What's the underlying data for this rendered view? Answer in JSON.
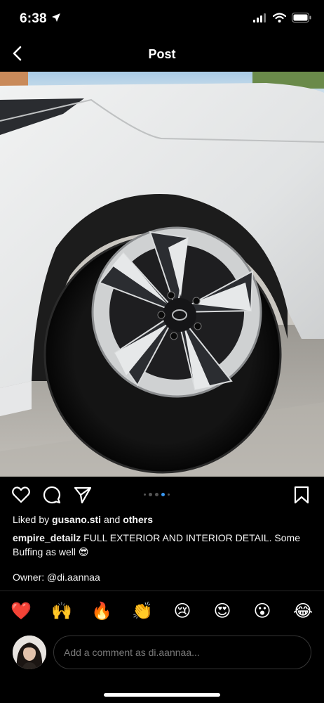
{
  "status": {
    "time": "6:38"
  },
  "nav": {
    "title": "Post"
  },
  "carousel": {
    "count": 5,
    "active": 3
  },
  "post": {
    "liked_prefix": "Liked by ",
    "liked_user": "gusano.sti",
    "liked_mid": " and ",
    "liked_others": "others",
    "caption_user": "empire_detailz",
    "caption_text": " FULL EXTERIOR AND INTERIOR DETAIL. Some Buffing as well 😎",
    "owner": "Owner: @di.aannaa"
  },
  "reactions": [
    "❤️",
    "🙌",
    "🔥",
    "👏",
    "😢",
    "😍",
    "😮",
    "😂"
  ],
  "comment": {
    "placeholder": "Add a comment as di.aannaa..."
  },
  "colors": {
    "background": "#000000",
    "accent": "#3897f0",
    "placeholder": "#7a7a7a"
  },
  "icons": [
    "location-arrow-icon",
    "signal-icon",
    "wifi-icon",
    "battery-icon",
    "back-chevron-icon",
    "heart-icon",
    "comment-icon",
    "share-icon",
    "bookmark-icon"
  ]
}
